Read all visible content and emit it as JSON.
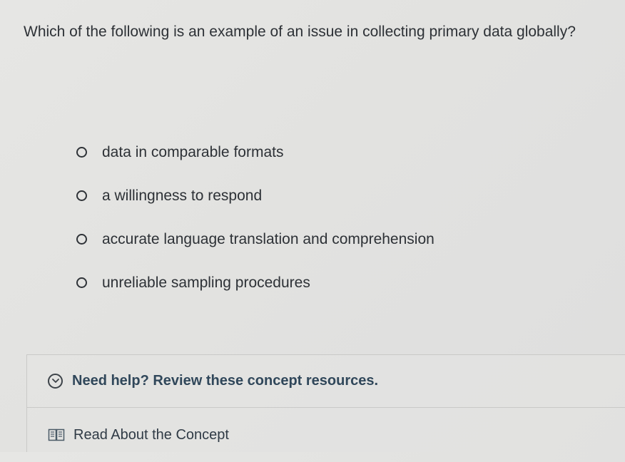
{
  "question": {
    "text": "Which of the following is an example of an issue in collecting primary data globally?"
  },
  "options": [
    {
      "label": "data in comparable formats",
      "selected": false
    },
    {
      "label": "a willingness to respond",
      "selected": false
    },
    {
      "label": "accurate language translation and comprehension",
      "selected": false
    },
    {
      "label": "unreliable sampling procedures",
      "selected": false
    }
  ],
  "help": {
    "title": "Need help? Review these concept resources.",
    "icon": "chevron-down-circle-icon",
    "resources": [
      {
        "label": "Read About the Concept",
        "icon": "book-icon"
      }
    ]
  }
}
